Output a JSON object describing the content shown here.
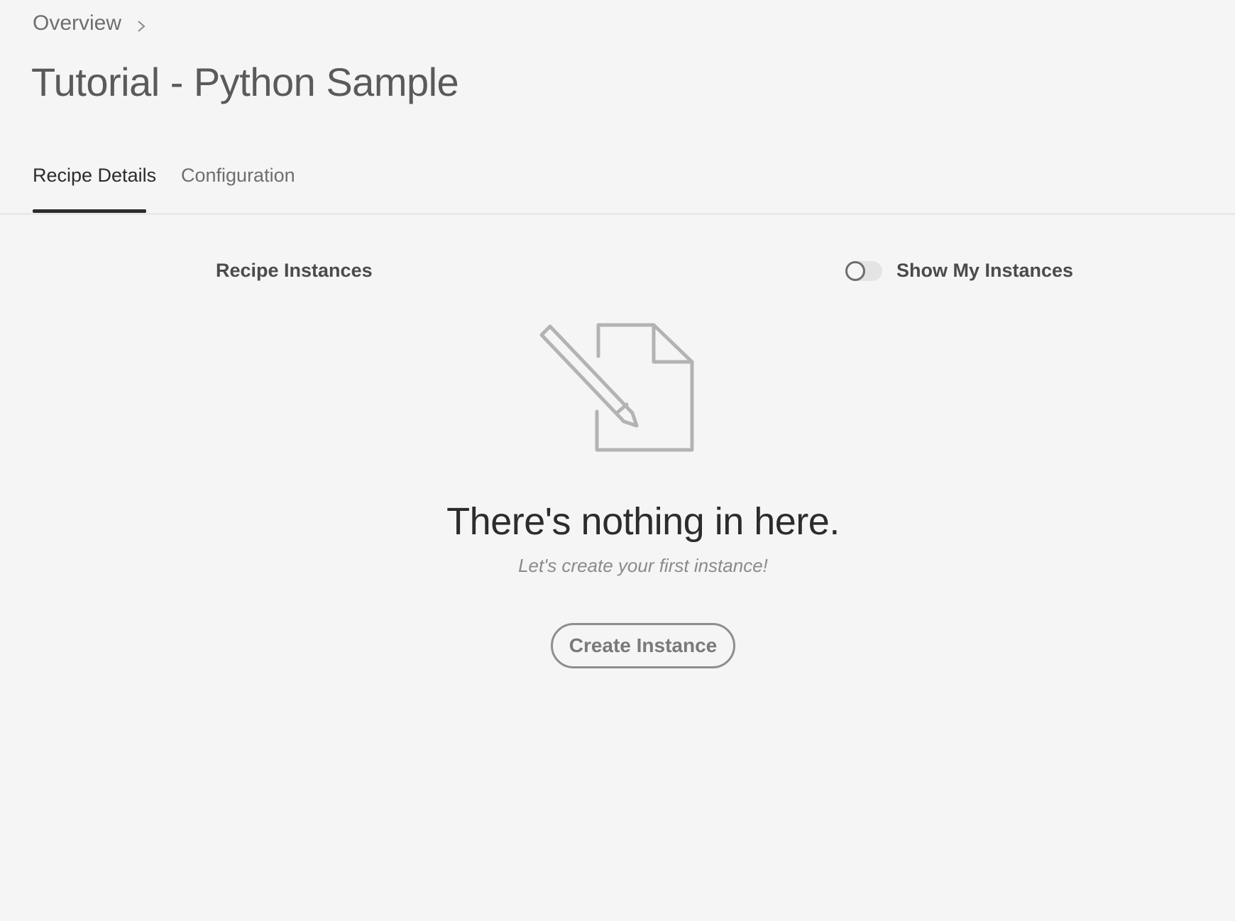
{
  "breadcrumb": {
    "items": [
      "Overview"
    ]
  },
  "page": {
    "title": "Tutorial - Python Sample"
  },
  "tabs": [
    {
      "label": "Recipe Details",
      "active": true
    },
    {
      "label": "Configuration",
      "active": false
    }
  ],
  "instances": {
    "heading": "Recipe Instances",
    "toggle_label": "Show My Instances",
    "toggle_on": false
  },
  "empty_state": {
    "icon": "document-edit-icon",
    "title": "There's nothing in here.",
    "subtitle": "Let's create your first instance!",
    "button_label": "Create Instance"
  },
  "colors": {
    "background": "#f5f5f5",
    "text_dark": "#2c2c2c",
    "text_muted": "#6e6e6e",
    "icon_gray": "#b3b3b3"
  }
}
